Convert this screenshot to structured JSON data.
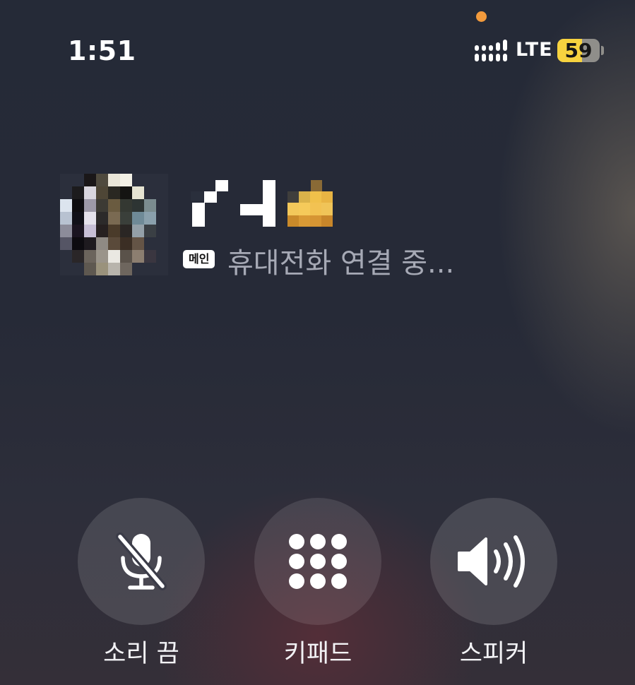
{
  "status_bar": {
    "time": "1:51",
    "network": "LTE",
    "battery": {
      "percent_text": "59",
      "level": 0.59,
      "fill_color": "#f7d33f"
    },
    "privacy_indicator_color": "#f29a3c"
  },
  "caller": {
    "avatar": "pixelated-profile-photo",
    "name_display": "pixelated-name",
    "line_badge": "메인",
    "status": "휴대전화 연결 중..."
  },
  "controls": [
    {
      "id": "mute",
      "label": "소리 끔",
      "icon": "mic-slash-icon"
    },
    {
      "id": "keypad",
      "label": "키패드",
      "icon": "keypad-icon"
    },
    {
      "id": "speaker",
      "label": "스피커",
      "icon": "speaker-wave-icon"
    }
  ]
}
